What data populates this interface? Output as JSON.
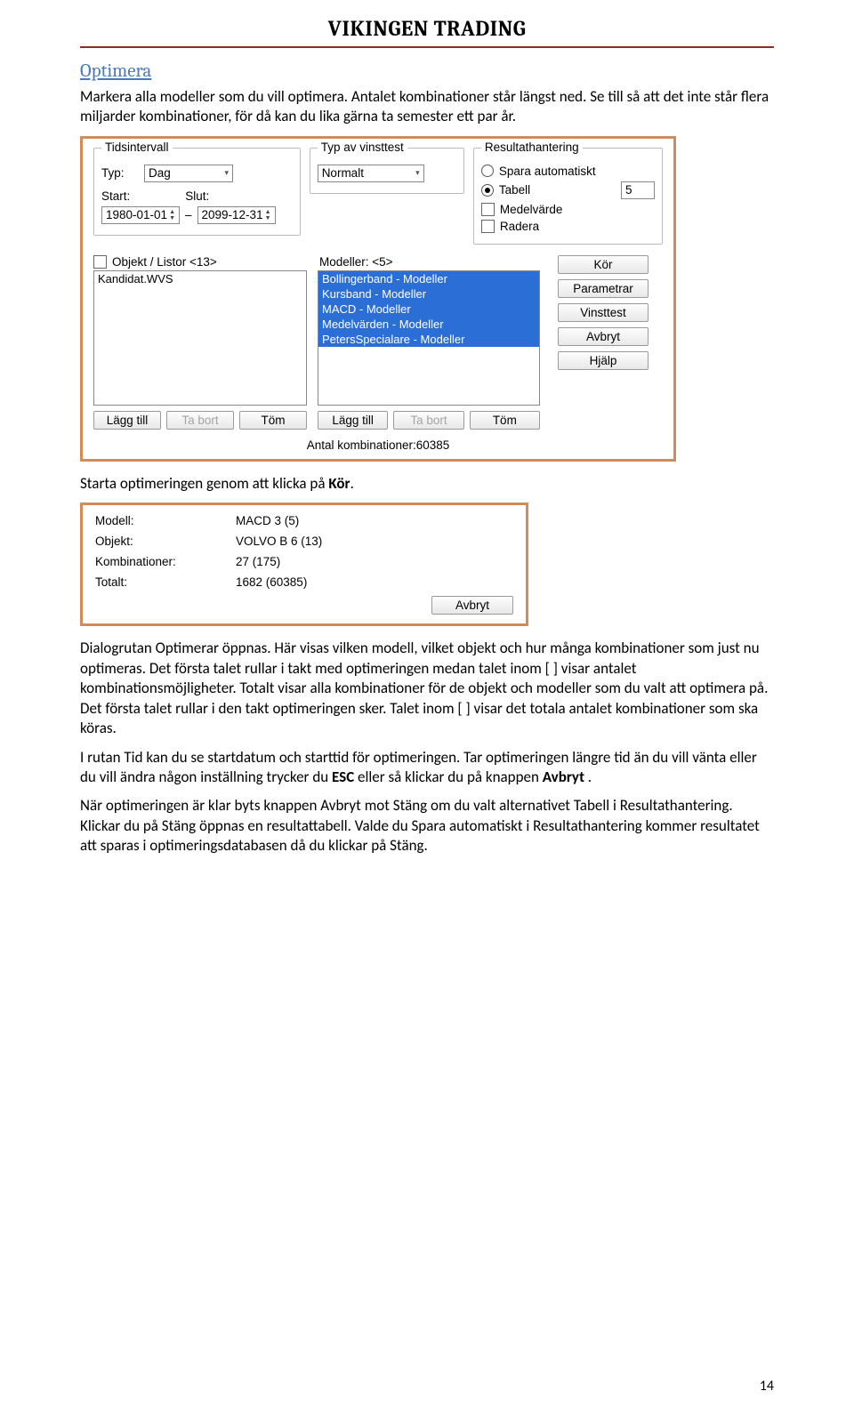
{
  "doc": {
    "title": "VIKINGEN TRADING",
    "section_head": "Optimera",
    "p1": "Markera alla modeller som du vill optimera. Antalet kombinationer står längst ned. Se till så att det inte står flera miljarder kombinationer, för då kan du lika gärna ta semester ett par år.",
    "p2a": "Starta optimeringen genom att klicka på ",
    "p2b_bold": "Kör",
    "p2c": ".",
    "p3": "Dialogrutan Optimerar öppnas. Här visas vilken modell, vilket objekt och hur många kombinationer som just nu optimeras. Det första talet rullar i takt med optimeringen medan talet inom [ ] visar antalet kombinationsmöjligheter. Totalt visar alla kombinationer för de objekt och modeller som du valt att optimera på. Det första talet rullar i den takt optimeringen sker. Talet inom [ ] visar det totala antalet kombinationer som ska köras.",
    "p4a": "I rutan Tid kan du se startdatum och starttid för optimeringen. Tar optimeringen längre tid än du vill vänta eller du vill ändra någon inställning trycker du ",
    "p4b_bold": "ESC",
    "p4c": " eller så klickar du på knappen ",
    "p4d_bold": "Avbryt",
    "p4e": " .",
    "p5": "När optimeringen är klar byts knappen Avbryt mot Stäng om du valt alternativet Tabell i Resultathantering. Klickar du på Stäng öppnas en resultattabell. Valde du Spara automatiskt i Resultathantering kommer resultatet att sparas i optimeringsdatabasen då du klickar på Stäng.",
    "page_number": "14"
  },
  "dlg1": {
    "tids": {
      "legend": "Tidsintervall",
      "typ_label": "Typ:",
      "typ_value": "Dag",
      "start_label": "Start:",
      "start_value": "1980-01-01",
      "dash": "–",
      "slut_label": "Slut:",
      "slut_value": "2099-12-31"
    },
    "vinst": {
      "legend": "Typ av vinsttest",
      "value": "Normalt"
    },
    "result": {
      "legend": "Resultathantering",
      "opt_spara": "Spara automatiskt",
      "opt_tabell": "Tabell",
      "tabell_n": "5",
      "chk_medel": "Medelvärde",
      "chk_radera": "Radera"
    },
    "objekt": {
      "hdr_label": "Objekt / Listor <13>",
      "items": [
        "Kandidat.WVS"
      ]
    },
    "modeller": {
      "hdr_label": "Modeller: <5>",
      "items": [
        "Bollingerband - Modeller",
        "Kursband - Modeller",
        "MACD - Modeller",
        "Medelvärden - Modeller",
        "PetersSpecialare - Modeller"
      ]
    },
    "sidebtns": {
      "kor": "Kör",
      "parametrar": "Parametrar",
      "vinsttest": "Vinsttest",
      "avbryt": "Avbryt",
      "hjalp": "Hjälp"
    },
    "listbtns": {
      "lagg_till": "Lägg till",
      "ta_bort": "Ta bort",
      "tom": "Töm"
    },
    "footer": "Antal kombinationer:60385"
  },
  "dlg2": {
    "rows": {
      "modell_l": "Modell:",
      "modell_v": "MACD  3 (5)",
      "objekt_l": "Objekt:",
      "objekt_v": "VOLVO B  6 (13)",
      "komb_l": "Kombinationer:",
      "komb_v": "27 (175)",
      "totalt_l": "Totalt:",
      "totalt_v": "1682 (60385)"
    },
    "avbryt": "Avbryt"
  }
}
